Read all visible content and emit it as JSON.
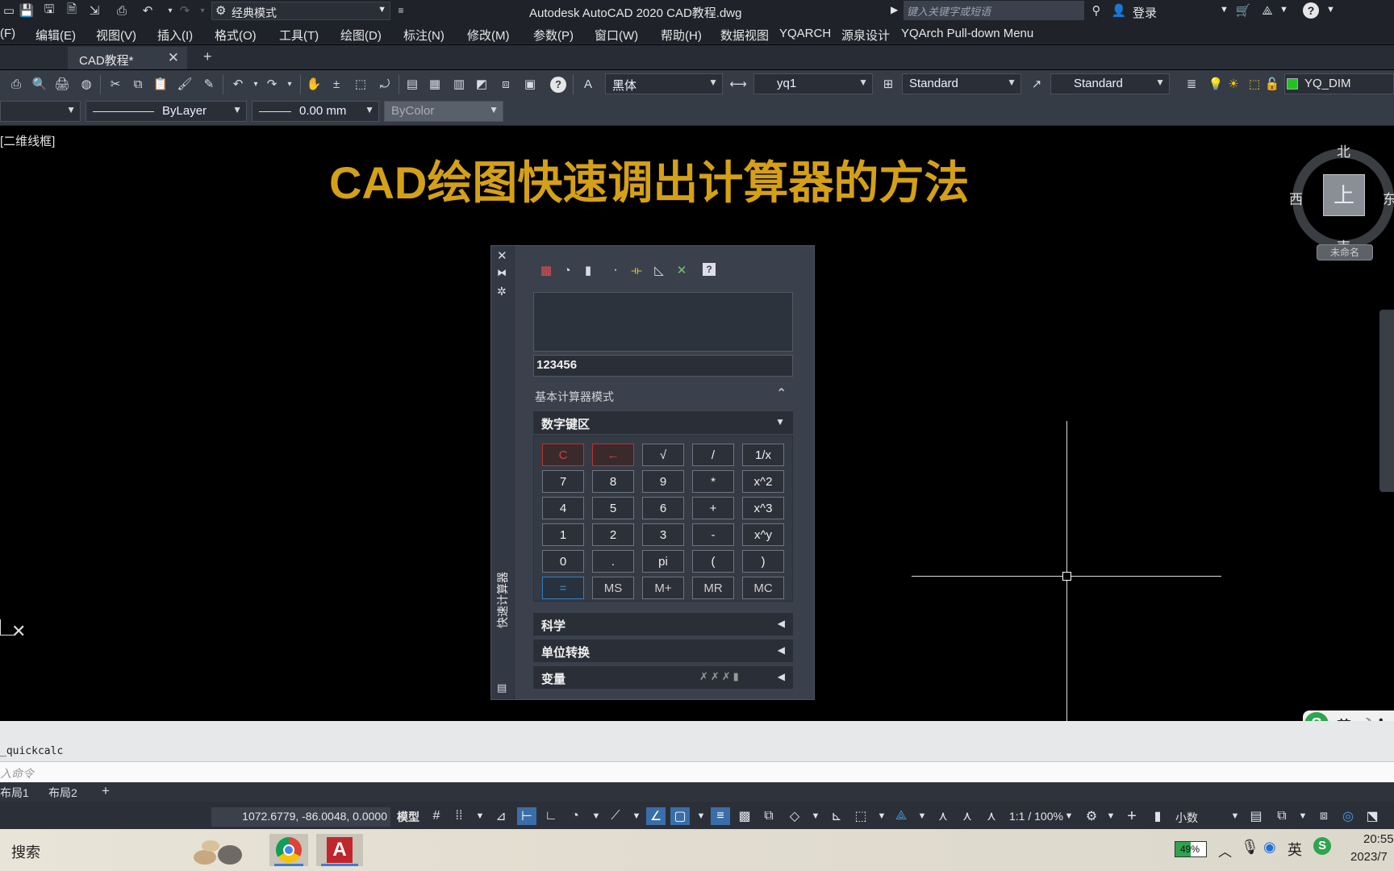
{
  "titlebar": {
    "workspace": "经典模式",
    "title": "Autodesk AutoCAD 2020    CAD教程.dwg",
    "search_placeholder": "键入关键字或短语",
    "login": "登录"
  },
  "menubar": {
    "items": [
      "(F)",
      "编辑(E)",
      "视图(V)",
      "插入(I)",
      "格式(O)",
      "工具(T)",
      "绘图(D)",
      "标注(N)",
      "修改(M)",
      "参数(P)",
      "窗口(W)",
      "帮助(H)",
      "数据视图",
      "YQARCH",
      "源泉设计",
      "YQArch Pull-down Menu"
    ]
  },
  "tabs": {
    "active": "CAD教程*",
    "add": "+"
  },
  "toolbar1": {
    "font": "黑体",
    "dimstyle": "yq1",
    "tablestyle": "Standard",
    "mleaderstyle": "Standard",
    "layer": "YQ_DIM"
  },
  "toolbar2": {
    "linetype": "ByLayer",
    "lineweight": "0.00 mm",
    "plotstyle": "ByColor"
  },
  "canvas": {
    "viewport_label": "[二维线框]",
    "headline": "CAD绘图快速调出计算器的方法",
    "viewcube": {
      "north": "北",
      "south": "南",
      "west": "西",
      "east": "东",
      "top": "上",
      "ucs": "未命名"
    },
    "accent_color": "#d4a017"
  },
  "calculator": {
    "side_title": "快速计算器",
    "input_value": "123456",
    "mode_label": "基本计算器模式",
    "numpad_title": "数字键区",
    "keys": [
      [
        "C",
        "←",
        "√",
        "/",
        "1/x"
      ],
      [
        "7",
        "8",
        "9",
        "*",
        "x^2"
      ],
      [
        "4",
        "5",
        "6",
        "+",
        "x^3"
      ],
      [
        "1",
        "2",
        "3",
        "-",
        "x^y"
      ],
      [
        "0",
        ".",
        "pi",
        "(",
        ")"
      ],
      [
        "=",
        "MS",
        "M+",
        "MR",
        "MC"
      ]
    ],
    "sections": [
      "科学",
      "单位转换",
      "变量"
    ]
  },
  "command": {
    "history": "_quickcalc",
    "input_placeholder": "入命令"
  },
  "layouts": {
    "tabs": [
      "布局1",
      "布局2"
    ],
    "add": "+"
  },
  "statusbar": {
    "coords": "1072.6779, -86.0048, 0.0000",
    "model": "模型",
    "scale": "1:1 / 100%",
    "units": "小数"
  },
  "taskbar": {
    "search": "搜索",
    "battery": "49%",
    "ime": "英",
    "time": "20:55",
    "date": "2023/7"
  },
  "ime_floating": {
    "label": "英"
  }
}
